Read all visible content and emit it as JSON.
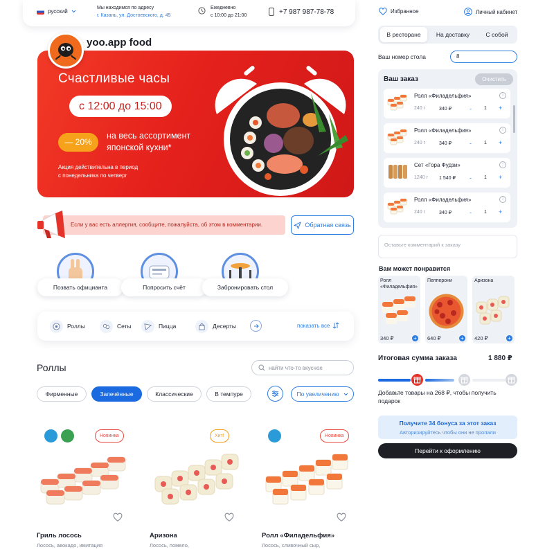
{
  "topbar": {
    "language": "русский",
    "address_label": "Мы находимся по адресу",
    "address": "г. Казань, ул. Достоевского, д. 45",
    "hours_label": "Ежедневно",
    "hours": "с 10:00 до 21:00",
    "phone": "+7 987 987-78-78"
  },
  "user_links": {
    "favorites": "Избранное",
    "account": "Личный кабинет"
  },
  "brand": {
    "name": "yoo.app food"
  },
  "banner": {
    "title": "Счастливые часы",
    "time": "с 12:00 до 15:00",
    "discount": "— 20%",
    "range_line1": "на весь ассортимент",
    "range_line2": "японской кухни*",
    "note_line1": "Акция действительна в период",
    "note_line2": "с понедельника по четверг"
  },
  "allergy_notice": "Если у вас есть аллергия, сообщите, пожалуйста, об этом в комментарии.",
  "feedback_label": "Обратная связь",
  "actions": [
    "Позвать официанта",
    "Попросить счёт",
    "Забронировать стол"
  ],
  "categories": [
    "Роллы",
    "Сеты",
    "Пицца",
    "Десерты"
  ],
  "show_all": "показать все",
  "section": {
    "title": "Роллы",
    "search_placeholder": "найти что-то вкусное",
    "filters": [
      "Фирменные",
      "Запечённые",
      "Классические",
      "В темпуре"
    ],
    "active_filter": "Запечённые",
    "sort": "По увеличению"
  },
  "products": [
    {
      "name": "Гриль лосось",
      "desc": "Лосось, авокадо, имитация",
      "badge": "Новинка"
    },
    {
      "name": "Аризона",
      "desc": "Лосось, помело,",
      "badge": "Хит!"
    },
    {
      "name": "Ролл «Филадельфия»",
      "desc": "Лосось, сливочный сыр,",
      "badge": "Новинка"
    }
  ],
  "order_type_tabs": [
    "В ресторане",
    "На доставку",
    "С собой"
  ],
  "active_tab": "В ресторане",
  "table": {
    "label": "Ваш номер стола",
    "value": "8"
  },
  "order": {
    "title": "Ваш заказ",
    "clear": "Очистить",
    "items": [
      {
        "name": "Ролл «Филадельфия»",
        "weight": "240 г",
        "price": "340 ₽",
        "qty": "1"
      },
      {
        "name": "Ролл «Филадельфия»",
        "weight": "240 г",
        "price": "340 ₽",
        "qty": "1"
      },
      {
        "name": "Сет «Гора Фудзи»",
        "weight": "1240 г",
        "price": "1 540 ₽",
        "qty": "1"
      },
      {
        "name": "Ролл «Филадельфия»",
        "weight": "240 г",
        "price": "340 ₽",
        "qty": "1"
      }
    ],
    "minus": "-",
    "plus": "+",
    "comment_placeholder": "Оставьте комментарий к заказу"
  },
  "recommendations": {
    "title": "Вам может понравится",
    "items": [
      {
        "name1": "Ролл",
        "name2": "«Филадельфия»",
        "price": "340 ₽"
      },
      {
        "name1": "Пепперони",
        "name2": "",
        "price": "640 ₽"
      },
      {
        "name1": "Аризона",
        "name2": "",
        "price": "420 ₽"
      }
    ]
  },
  "total": {
    "label": "Итоговая сумма заказа",
    "value": "1 880 ₽"
  },
  "gift_progress": {
    "line1": "Добавьте товары на 268 ₽, чтобы получить",
    "line2": "подарок",
    "levels_reached": 1,
    "levels_total": 3
  },
  "bonus": {
    "title": "Получите 34 бонуса за этот заказ",
    "subtitle": "Авторизируйтесь чтобы они не пропали"
  },
  "checkout": "Перейти к оформлению",
  "colors": {
    "accent": "#2e7ee0",
    "banner_red": "#e5211c",
    "discount_orange": "#f7a21b",
    "allergy_bg": "#fcd3cf",
    "badge_red": "#e84a3f",
    "badge_orange": "#f59b1c",
    "checkout_bg": "#1f2026"
  },
  "icons": [
    "flag-russia-icon",
    "chevron-down-icon",
    "location-icon",
    "clock-icon",
    "phone-icon",
    "heart-icon",
    "user-icon",
    "megaphone-icon",
    "send-icon",
    "waiter-icon",
    "bill-icon",
    "table-icon",
    "roll-icon",
    "set-icon",
    "pizza-icon",
    "dessert-icon",
    "arrow-right-icon",
    "sort-icon",
    "search-icon",
    "filter-icon",
    "info-icon",
    "gift-icon",
    "fish-icon",
    "leaf-icon"
  ]
}
